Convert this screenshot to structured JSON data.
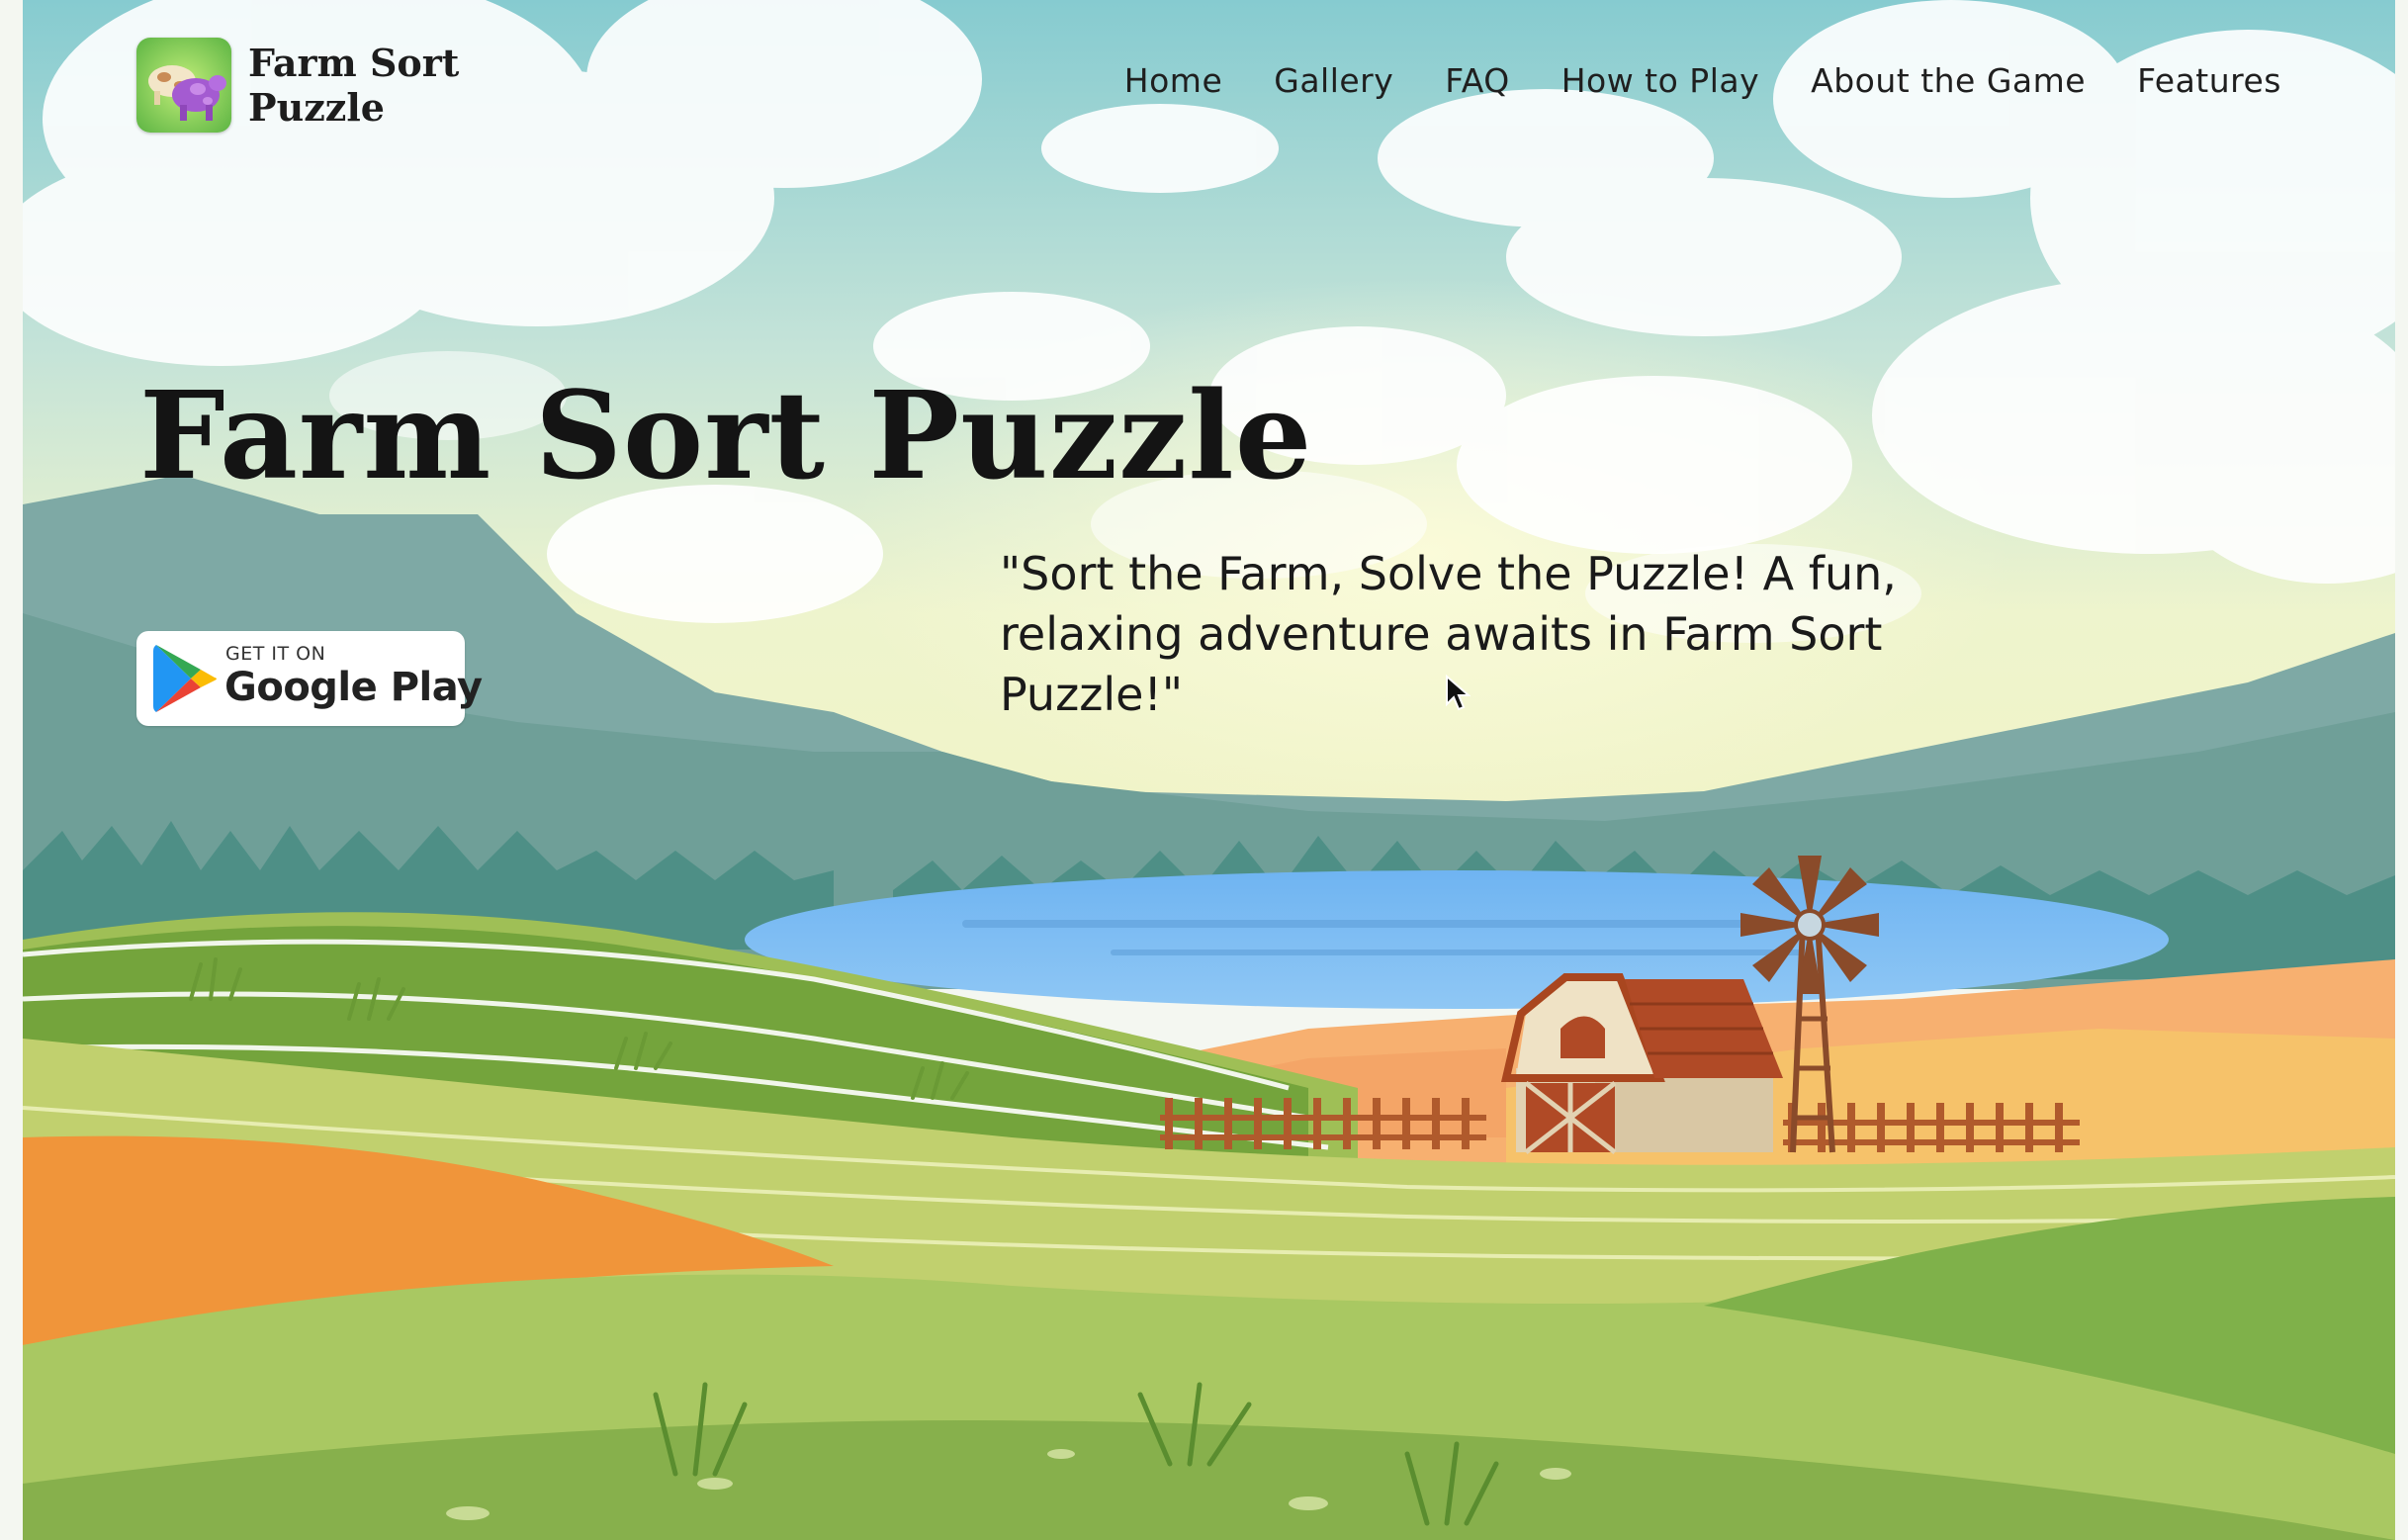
{
  "header": {
    "brand_name": "Farm Sort Puzzle",
    "nav": [
      "Home",
      "Gallery",
      "FAQ",
      "How to Play",
      "About the Game",
      "Features"
    ]
  },
  "hero": {
    "title": "Farm Sort Puzzle",
    "tagline": "\"Sort the Farm, Solve the Puzzle! A fun, relaxing adventure awaits in Farm Sort Puzzle!\""
  },
  "store_badge": {
    "small_text": "GET IT ON",
    "big_text": "Google Play",
    "icon": "google-play-icon"
  },
  "colors": {
    "sky_top": "#8ccfd2",
    "sky_glow": "#f1f6c8",
    "mountain": "#7aa8a5",
    "lake": "#6fb3ef",
    "field_green": "#b7cb6b",
    "field_orange": "#f0953a",
    "barn_roof": "#b04a26",
    "text": "#141414"
  }
}
